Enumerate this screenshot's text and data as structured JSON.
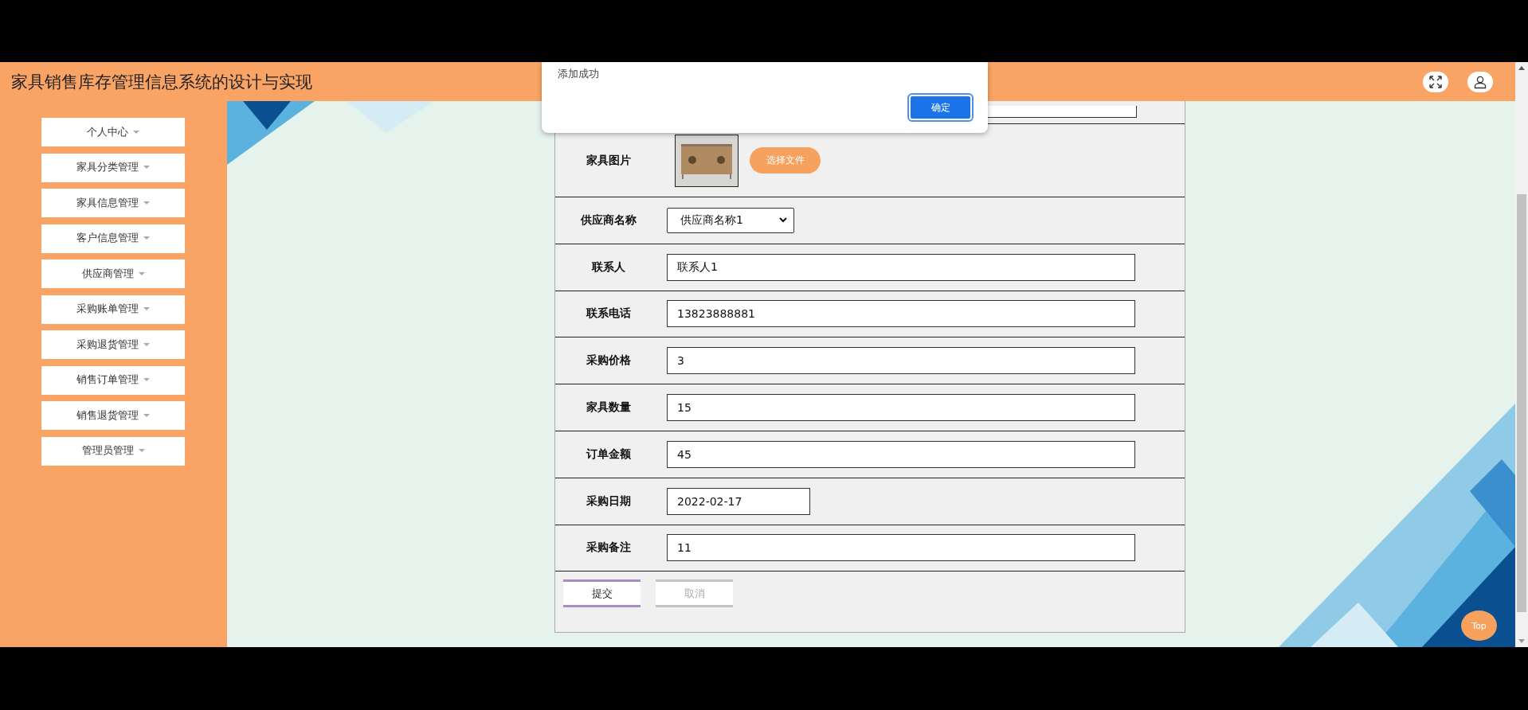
{
  "header": {
    "title": "家具销售库存管理信息系统的设计与实现"
  },
  "dialog": {
    "message": "添加成功",
    "confirm": "确定"
  },
  "sidebar": {
    "items": [
      {
        "label": "个人中心"
      },
      {
        "label": "家具分类管理"
      },
      {
        "label": "家具信息管理"
      },
      {
        "label": "客户信息管理"
      },
      {
        "label": "供应商管理"
      },
      {
        "label": "采购账单管理"
      },
      {
        "label": "采购退货管理"
      },
      {
        "label": "销售订单管理"
      },
      {
        "label": "销售退货管理"
      },
      {
        "label": "管理员管理"
      }
    ]
  },
  "form": {
    "fields": [
      {
        "kind": "image",
        "label": "家具图片",
        "button": "选择文件"
      },
      {
        "kind": "select",
        "label": "供应商名称",
        "value": "供应商名称1"
      },
      {
        "kind": "text",
        "label": "联系人",
        "value": "联系人1"
      },
      {
        "kind": "text",
        "label": "联系电话",
        "value": "13823888881"
      },
      {
        "kind": "text",
        "label": "采购价格",
        "value": "3"
      },
      {
        "kind": "text",
        "label": "家具数量",
        "value": "15"
      },
      {
        "kind": "text",
        "label": "订单金额",
        "value": "45"
      },
      {
        "kind": "date",
        "label": "采购日期",
        "value": "2022-02-17"
      },
      {
        "kind": "text",
        "label": "采购备注",
        "value": "11"
      }
    ],
    "buttons": [
      {
        "kind": "primary",
        "label": "提交"
      },
      {
        "kind": "secondary",
        "label": "取消"
      }
    ]
  },
  "top_button": {
    "label": "Top"
  }
}
